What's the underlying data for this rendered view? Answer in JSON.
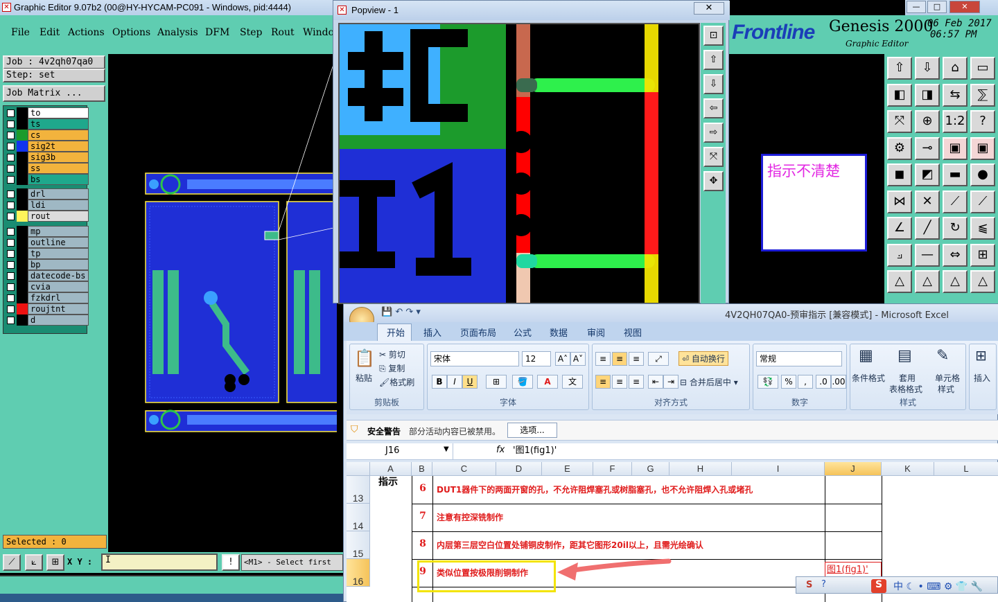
{
  "genesis": {
    "title": "Graphic Editor 9.07b2 (00@HY-HYCAM-PC091 - Windows, pid:4444)",
    "menu": [
      "File",
      "Edit",
      "Actions",
      "Options",
      "Analysis",
      "DFM",
      "Step",
      "Rout",
      "Windo"
    ],
    "logo": "Frontline",
    "product": "Genesis 2000",
    "product_sub": "Graphic Editor",
    "date": "06 Feb 2017",
    "time": "06:57 PM",
    "job_label": "Job  :  4v2qh07qa0",
    "step_label": "Step:  set",
    "job_matrix": "Job Matrix ...",
    "layers": [
      {
        "name": "to",
        "color": "#ffffff",
        "swatch": "#000000"
      },
      {
        "name": "ts",
        "color": "#1fa88c",
        "swatch": "#000000"
      },
      {
        "name": "cs",
        "color": "#f2b33d",
        "swatch": "#1c9b2c"
      },
      {
        "name": "sig2t",
        "color": "#f2b33d",
        "swatch": "#1133ee"
      },
      {
        "name": "sig3b",
        "color": "#f2b33d",
        "swatch": "#000000"
      },
      {
        "name": "ss",
        "color": "#f2b33d",
        "swatch": "#000000"
      },
      {
        "name": "bs",
        "color": "#1fa88c",
        "swatch": "#000000"
      },
      {
        "name": "drl",
        "color": "#9fb8c4",
        "swatch": "#000000"
      },
      {
        "name": "ldi",
        "color": "#9fb8c4",
        "swatch": "#000000"
      },
      {
        "name": "rout",
        "color": "#dcdcdc",
        "swatch": "#fff45a"
      },
      {
        "name": "mp",
        "color": "#9fb8c4",
        "swatch": "#000000"
      },
      {
        "name": "outline",
        "color": "#9fb8c4",
        "swatch": "#000000"
      },
      {
        "name": "tp",
        "color": "#9fb8c4",
        "swatch": "#000000"
      },
      {
        "name": "bp",
        "color": "#9fb8c4",
        "swatch": "#000000"
      },
      {
        "name": "datecode-bs",
        "color": "#9fb8c4",
        "swatch": "#000000"
      },
      {
        "name": "cvia",
        "color": "#9fb8c4",
        "swatch": "#000000"
      },
      {
        "name": "fzkdrl",
        "color": "#9fb8c4",
        "swatch": "#000000"
      },
      {
        "name": "roujtnt",
        "color": "#9fb8c4",
        "swatch": "#ee1111"
      },
      {
        "name": "d",
        "color": "#9fb8c4",
        "swatch": "#000000"
      }
    ],
    "selected": "Selected : 0",
    "xy_label": "X Y :",
    "xy_value": "I",
    "status": "<M1> - Select first",
    "note_text": "指示不清楚",
    "win_close": "✕",
    "win_max": "□",
    "win_min": "—"
  },
  "popview": {
    "title": "Popview - 1",
    "close": "✕"
  },
  "excel": {
    "title": "4V2QH07QA0-预审指示  [兼容模式] - Microsoft Excel",
    "tabs": [
      "开始",
      "插入",
      "页面布局",
      "公式",
      "数据",
      "审阅",
      "视图"
    ],
    "clipboard": {
      "paste": "粘贴",
      "cut": "剪切",
      "copy": "复制",
      "format_painter": "格式刷",
      "label": "剪贴板"
    },
    "font": {
      "name": "宋体",
      "size": "12",
      "label": "字体"
    },
    "align": {
      "wrap": "自动换行",
      "merge": "合并后居中",
      "label": "对齐方式"
    },
    "number": {
      "format": "常规",
      "label": "数字"
    },
    "styles": {
      "cond": "条件格式",
      "table": "套用",
      "table2": "表格格式",
      "cell": "单元格",
      "cell2": "样式",
      "label": "样式"
    },
    "insert": "插入",
    "security_title": "安全警告",
    "security_msg": "部分活动内容已被禁用。",
    "options_button": "选项...",
    "name_box": "J16",
    "formula": "'图1(fig1)'",
    "columns": [
      "A",
      "B",
      "C",
      "D",
      "E",
      "F",
      "G",
      "H",
      "I",
      "J",
      "K",
      "L"
    ],
    "rows": [
      {
        "row": "13",
        "num": "6",
        "text": "DUT1器件下的两面开窗的孔，不允许阻焊塞孔或树脂塞孔，也不允许阻焊入孔或堵孔"
      },
      {
        "row": "14",
        "num": "7",
        "text": "注意有控深铣制作"
      },
      {
        "row": "15",
        "num": "8",
        "text": "内层第三层空白位置处铺铜皮制作，距其它图形20il以上，且需光绘确认"
      },
      {
        "row": "16",
        "num": "9",
        "text": "类似位置按极限削铜制作"
      }
    ],
    "a_label": "指示",
    "j16_value": "图1(fig1)'"
  },
  "colors": {
    "genesis_teal": "#5fcdb1",
    "pcb_blue": "#1f2fd6",
    "highlight_yellow": "#f3e400",
    "arrow": "#f06f6f"
  }
}
